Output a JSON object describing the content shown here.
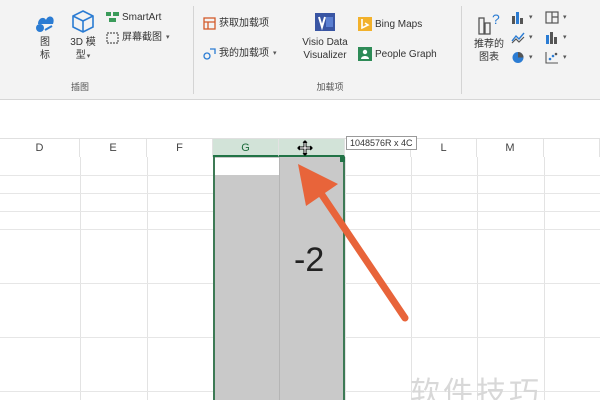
{
  "ribbon": {
    "illustrations": {
      "icons_label": "图\n标",
      "model3d_label": "3D 模\n型",
      "smartart_label": "SmartArt",
      "screenshot_label": "屏幕截图",
      "group_label": "插图"
    },
    "addins": {
      "get_addins_label": "获取加载项",
      "my_addins_label": "我的加载项",
      "visio_label": "Visio Data\nVisualizer",
      "bing_maps_label": "Bing Maps",
      "people_graph_label": "People Graph",
      "group_label": "加载项"
    },
    "charts": {
      "recommended_label": "推荐的\n图表"
    }
  },
  "columns": [
    "D",
    "E",
    "F",
    "G",
    "",
    "L",
    "M"
  ],
  "selected_columns": [
    "G"
  ],
  "tooltip": "1048576R x 4C",
  "cell_value": "-2",
  "watermark": "软件技巧",
  "colors": {
    "accent": "#217346",
    "selection_fill": "#c9c9c9",
    "arrow": "#e8643a"
  }
}
